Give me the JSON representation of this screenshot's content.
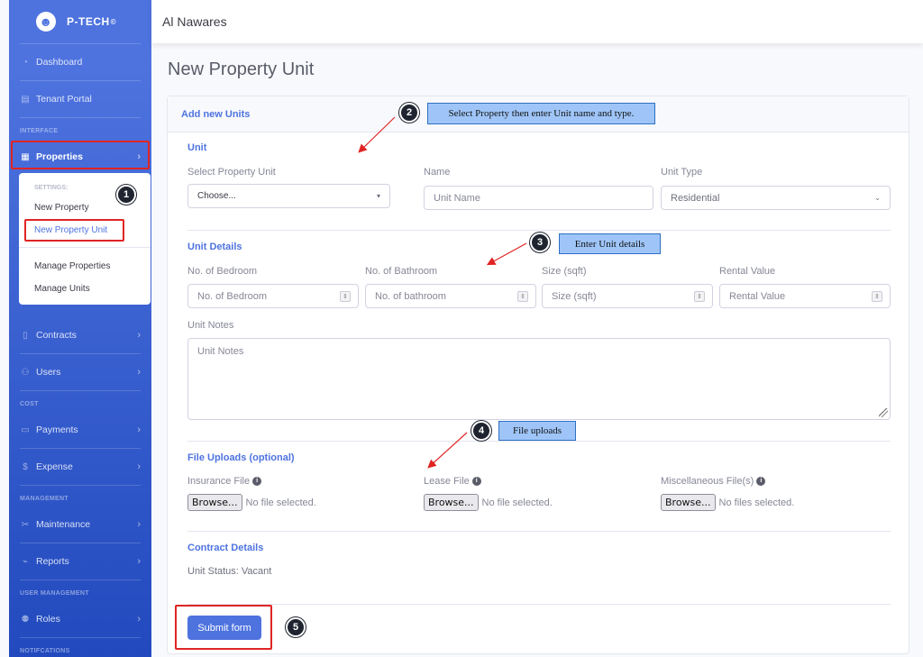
{
  "sidebar": {
    "brand": "P-TECH",
    "brand_mark": "©",
    "items": [
      {
        "label": "Dashboard",
        "icon": "dashboard-icon"
      },
      {
        "label": "Tenant Portal",
        "icon": "building-icon"
      },
      {
        "heading": "INTERFACE"
      },
      {
        "label": "Properties",
        "icon": "properties-icon"
      },
      {
        "label": "Contracts",
        "icon": "file-icon"
      },
      {
        "label": "Users",
        "icon": "users-icon"
      },
      {
        "heading": "COST"
      },
      {
        "label": "Payments",
        "icon": "payments-icon"
      },
      {
        "label": "Expense",
        "icon": "dollar-icon"
      },
      {
        "heading": "MANAGEMENT"
      },
      {
        "label": "Maintenance",
        "icon": "tools-icon"
      },
      {
        "label": "Reports",
        "icon": "chart-icon"
      },
      {
        "heading": "USER MANAGEMENT"
      },
      {
        "label": "Roles",
        "icon": "roles-icon"
      },
      {
        "heading": "NOTIFCATIONS"
      }
    ],
    "submenu": {
      "heading": "SETTINGS:",
      "items": [
        "New Property",
        "New Property Unit",
        "Manage Properties",
        "Manage Units"
      ]
    }
  },
  "topbar": {
    "title": "Al Nawares"
  },
  "page": {
    "title": "New Property Unit"
  },
  "card": {
    "header": "Add new Units",
    "unit": {
      "title": "Unit",
      "property_label": "Select Property Unit",
      "property_value": "Choose...",
      "name_label": "Name",
      "name_placeholder": "Unit Name",
      "type_label": "Unit Type",
      "type_value": "Residential"
    },
    "details": {
      "title": "Unit Details",
      "bedroom_label": "No. of Bedroom",
      "bedroom_placeholder": "No. of Bedroom",
      "bathroom_label": "No. of Bathroom",
      "bathroom_placeholder": "No. of bathroom",
      "size_label": "Size (sqft)",
      "size_placeholder": "Size (sqft)",
      "rental_label": "Rental Value",
      "rental_placeholder": "Rental Value",
      "notes_label": "Unit Notes",
      "notes_placeholder": "Unit Notes"
    },
    "uploads": {
      "title": "File Uploads (optional)",
      "insurance_label": "Insurance File",
      "lease_label": "Lease File",
      "misc_label": "Miscellaneous File(s)",
      "browse": "Browse...",
      "no_file": "No file selected.",
      "no_files": "No files selected."
    },
    "contract": {
      "title": "Contract Details",
      "status": "Unit Status: Vacant"
    },
    "submit": "Submit form"
  },
  "annotations": {
    "badges": [
      "1",
      "2",
      "3",
      "4",
      "5"
    ],
    "callout_2": "Select Property then enter Unit name and type.",
    "callout_3": "Enter Unit details",
    "callout_4": "File uploads"
  },
  "colors": {
    "primary": "#4e73df",
    "annotation_red": "#e02424",
    "callout_blue": "#9fc5f8"
  }
}
